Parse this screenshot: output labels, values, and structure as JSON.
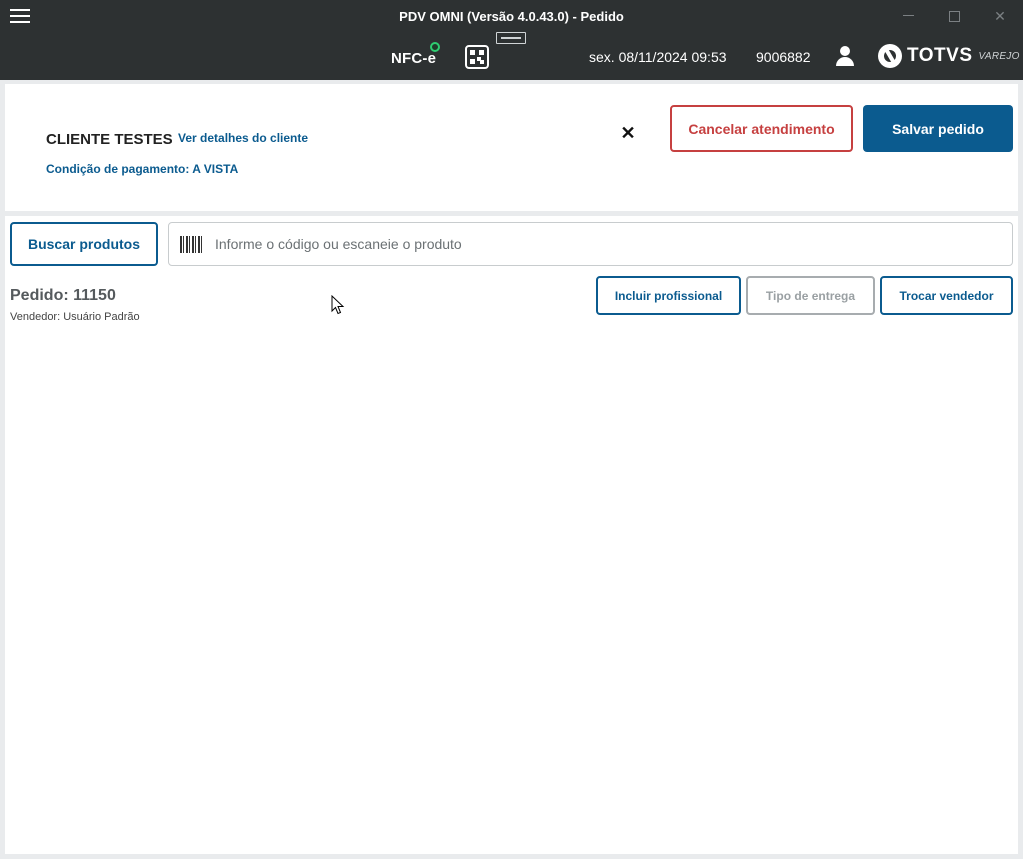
{
  "window": {
    "title": "PDV OMNI (Versão 4.0.43.0) - Pedido"
  },
  "header": {
    "fiscal_mode": "NFC-e",
    "datetime": "sex. 08/11/2024 09:53",
    "station_code": "9006882",
    "brand_name": "TOTVS",
    "brand_sub": "VAREJO",
    "status_color": "#2ecc71"
  },
  "customer": {
    "name": "CLIENTE TESTES",
    "details_link": "Ver detalhes do cliente",
    "payment_condition": "Condição de pagamento: A VISTA",
    "cancel_label": "Cancelar atendimento",
    "save_label": "Salvar pedido",
    "close_symbol": "✕"
  },
  "products": {
    "search_button": "Buscar produtos",
    "scan_placeholder": "Informe o código ou escaneie o produto"
  },
  "order": {
    "number_label": "Pedido: 11150",
    "seller_label": "Vendedor: Usuário Padrão",
    "include_professional": "Incluir profissional",
    "delivery_type": "Tipo de entrega",
    "change_seller": "Trocar vendedor"
  },
  "colors": {
    "primary": "#0b5b8f",
    "danger": "#c64040",
    "header_bg": "#2d3132"
  }
}
